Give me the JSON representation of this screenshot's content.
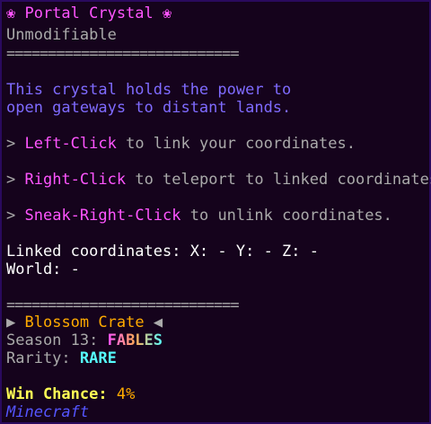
{
  "tooltip": {
    "title": "❀ Portal Crystal ❀",
    "unmodifiable": "Unmodifiable",
    "separator": "============================",
    "description": [
      "This crystal holds the power to",
      "open gateways to distant lands."
    ],
    "actions": [
      {
        "bullet": ">",
        "key": "Left-Click",
        "text": " to link your coordinates."
      },
      {
        "bullet": ">",
        "key": "Right-Click",
        "text": " to teleport to linked coordinates."
      },
      {
        "bullet": ">",
        "key": "Sneak-Right-Click",
        "text": " to unlink coordinates."
      }
    ],
    "linked": "Linked coordinates: X: - Y: - Z: -",
    "world": "World: -",
    "crate": {
      "prefix": "▶",
      "name": "Blossom Crate",
      "suffix": "◀"
    },
    "season_label": "Season 13: ",
    "season_value": "FABLES",
    "rarity_label": "Rarity: ",
    "rarity_value": "RARE",
    "win_label": "Win Chance: ",
    "win_value": "4%",
    "source": "Minecraft"
  },
  "colors": {
    "background": "#15031c",
    "border": "#2a0a5e",
    "pink": "#ff55ff",
    "gray": "#aaaaaa",
    "blue": "#7f6bff",
    "orange": "#ffaa00",
    "yellow": "#ffff55",
    "aqua": "#55ffff",
    "minecraft": "#5555ff"
  }
}
